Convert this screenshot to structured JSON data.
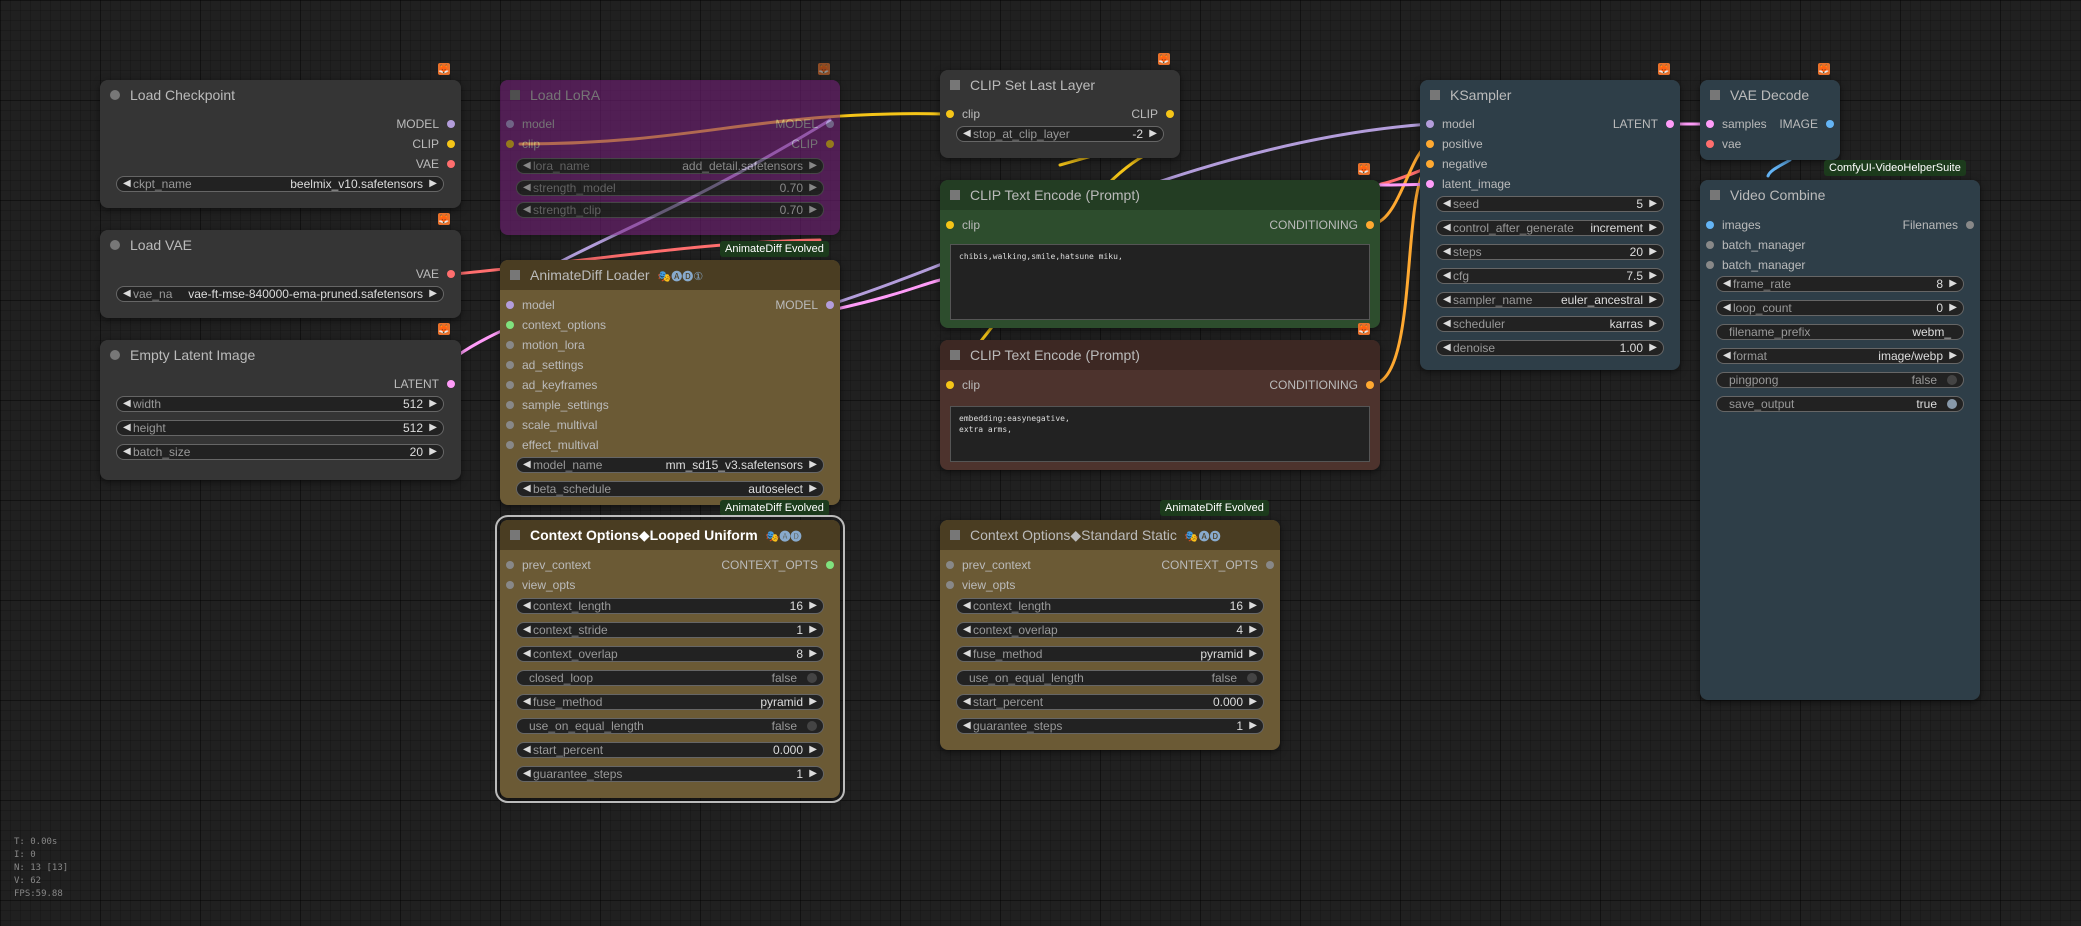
{
  "colors": {
    "model": "#b39ddb",
    "clip": "#f5c518",
    "vae": "#ff6e6e",
    "latent": "#ff9cf9",
    "conditioning": "#ffa931",
    "image": "#64b5f6",
    "context": "#80e27e"
  },
  "nodes": {
    "load_checkpoint": {
      "title": "Load Checkpoint",
      "outputs": [
        "MODEL",
        "CLIP",
        "VAE"
      ],
      "ckpt_name": {
        "label": "ckpt_name",
        "value": "beelmix_v10.safetensors"
      }
    },
    "load_lora": {
      "title": "Load LoRA",
      "inputs": [
        "model",
        "clip"
      ],
      "outputs": [
        "MODEL",
        "CLIP"
      ],
      "widgets": [
        {
          "label": "lora_name",
          "value": "add_detail.safetensors"
        },
        {
          "label": "strength_model",
          "value": "0.70"
        },
        {
          "label": "strength_clip",
          "value": "0.70"
        }
      ]
    },
    "load_vae": {
      "title": "Load VAE",
      "outputs": [
        "VAE"
      ],
      "vae_name": {
        "label": "vae_na",
        "value": "vae-ft-mse-840000-ema-pruned.safetensors"
      }
    },
    "empty_latent": {
      "title": "Empty Latent Image",
      "outputs": [
        "LATENT"
      ],
      "widgets": [
        {
          "label": "width",
          "value": "512"
        },
        {
          "label": "height",
          "value": "512"
        },
        {
          "label": "batch_size",
          "value": "20"
        }
      ]
    },
    "animatediff_loader": {
      "badge": "AnimateDiff Evolved",
      "title": "AnimateDiff Loader",
      "title_icons": "🎭🅐🅓①",
      "inputs": [
        "model",
        "context_options",
        "motion_lora",
        "ad_settings",
        "ad_keyframes",
        "sample_settings",
        "scale_multival",
        "effect_multival"
      ],
      "outputs": [
        "MODEL"
      ],
      "widgets": [
        {
          "label": "model_name",
          "value": "mm_sd15_v3.safetensors"
        },
        {
          "label": "beta_schedule",
          "value": "autoselect"
        }
      ]
    },
    "context_looped": {
      "badge": "AnimateDiff Evolved",
      "title": "Context Options◆Looped Uniform",
      "title_icons": "🎭🅐🅓",
      "inputs": [
        "prev_context",
        "view_opts"
      ],
      "outputs": [
        "CONTEXT_OPTS"
      ],
      "widgets": [
        {
          "kind": "num",
          "label": "context_length",
          "value": "16"
        },
        {
          "kind": "num",
          "label": "context_stride",
          "value": "1"
        },
        {
          "kind": "num",
          "label": "context_overlap",
          "value": "8"
        },
        {
          "kind": "toggle",
          "label": "closed_loop",
          "value": "false"
        },
        {
          "kind": "num",
          "label": "fuse_method",
          "value": "pyramid"
        },
        {
          "kind": "toggle",
          "label": "use_on_equal_length",
          "value": "false"
        },
        {
          "kind": "num",
          "label": "start_percent",
          "value": "0.000"
        },
        {
          "kind": "num",
          "label": "guarantee_steps",
          "value": "1"
        }
      ]
    },
    "clip_set_last_layer": {
      "title": "CLIP Set Last Layer",
      "inputs": [
        "clip"
      ],
      "outputs": [
        "CLIP"
      ],
      "widgets": [
        {
          "label": "stop_at_clip_layer",
          "value": "-2"
        }
      ]
    },
    "clip_text_pos": {
      "title": "CLIP Text Encode (Prompt)",
      "inputs": [
        "clip"
      ],
      "outputs": [
        "CONDITIONING"
      ],
      "text": "chibis,walking,smile,hatsune miku,"
    },
    "clip_text_neg": {
      "title": "CLIP Text Encode (Prompt)",
      "inputs": [
        "clip"
      ],
      "outputs": [
        "CONDITIONING"
      ],
      "text": "embedding:easynegative,\nextra arms,"
    },
    "context_standard": {
      "badge": "AnimateDiff Evolved",
      "title": "Context Options◆Standard Static",
      "title_icons": "🎭🅐🅓",
      "inputs": [
        "prev_context",
        "view_opts"
      ],
      "outputs": [
        "CONTEXT_OPTS"
      ],
      "widgets": [
        {
          "kind": "num",
          "label": "context_length",
          "value": "16"
        },
        {
          "kind": "num",
          "label": "context_overlap",
          "value": "4"
        },
        {
          "kind": "num",
          "label": "fuse_method",
          "value": "pyramid"
        },
        {
          "kind": "toggle",
          "label": "use_on_equal_length",
          "value": "false"
        },
        {
          "kind": "num",
          "label": "start_percent",
          "value": "0.000"
        },
        {
          "kind": "num",
          "label": "guarantee_steps",
          "value": "1"
        }
      ]
    },
    "ksampler": {
      "title": "KSampler",
      "inputs": [
        "model",
        "positive",
        "negative",
        "latent_image"
      ],
      "outputs": [
        "LATENT"
      ],
      "widgets": [
        {
          "label": "seed",
          "value": "5"
        },
        {
          "label": "control_after_generate",
          "value": "increment"
        },
        {
          "label": "steps",
          "value": "20"
        },
        {
          "label": "cfg",
          "value": "7.5"
        },
        {
          "label": "sampler_name",
          "value": "euler_ancestral"
        },
        {
          "label": "scheduler",
          "value": "karras"
        },
        {
          "label": "denoise",
          "value": "1.00"
        }
      ]
    },
    "vae_decode": {
      "title": "VAE Decode",
      "inputs": [
        "samples",
        "vae"
      ],
      "outputs": [
        "IMAGE"
      ]
    },
    "video_combine": {
      "badge": "ComfyUI-VideoHelperSuite",
      "title": "Video Combine",
      "inputs": [
        "images",
        "batch_manager",
        "batch_manager"
      ],
      "outputs": [
        "Filenames"
      ],
      "widgets": [
        {
          "kind": "num",
          "label": "frame_rate",
          "value": "8"
        },
        {
          "kind": "num",
          "label": "loop_count",
          "value": "0"
        },
        {
          "kind": "text",
          "label": "filename_prefix",
          "value": "webm_"
        },
        {
          "kind": "num",
          "label": "format",
          "value": "image/webp"
        },
        {
          "kind": "toggle",
          "label": "pingpong",
          "value": "false"
        },
        {
          "kind": "toggle-on",
          "label": "save_output",
          "value": "true"
        }
      ]
    }
  },
  "stats": {
    "t": "T: 0.00s",
    "i": "I: 0",
    "n": "N: 13 [13]",
    "v": "V: 62",
    "fps": "FPS:59.88"
  }
}
